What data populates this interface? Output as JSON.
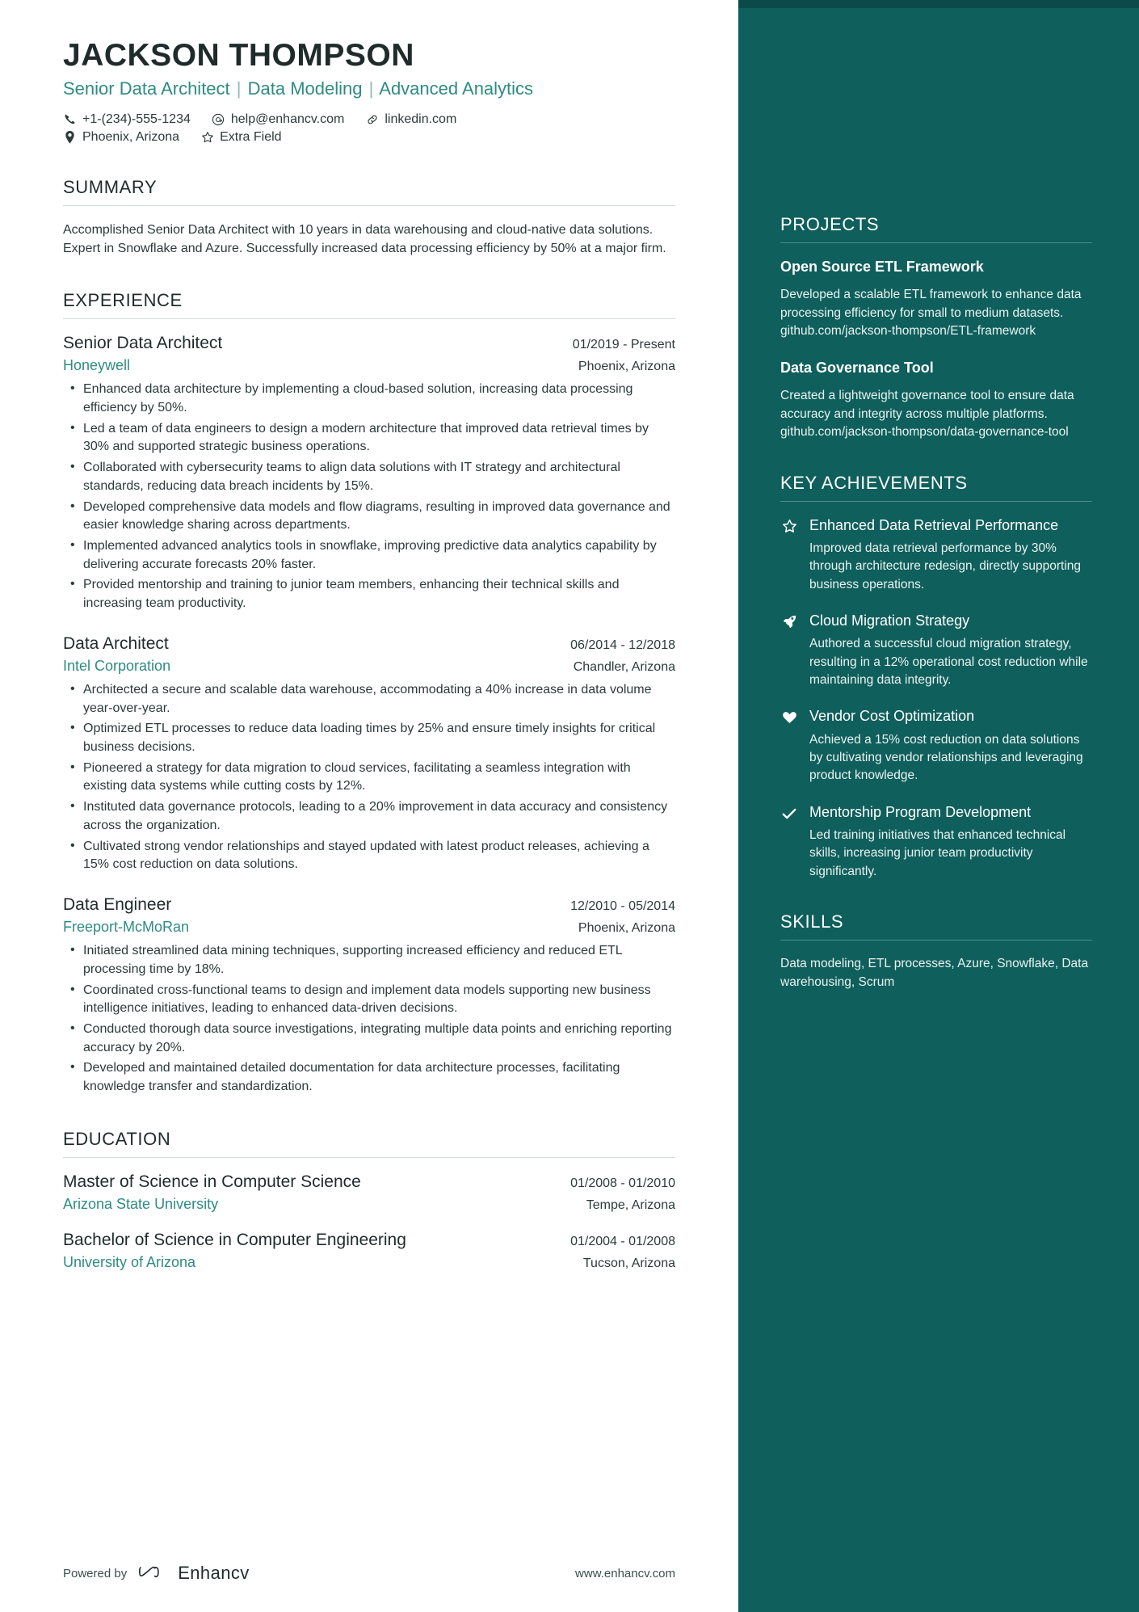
{
  "header": {
    "name": "JACKSON THOMPSON",
    "headline_parts": [
      "Senior Data Architect",
      "Data Modeling",
      "Advanced Analytics"
    ],
    "headline_separator": "|",
    "contacts_row1": [
      {
        "icon": "phone-icon",
        "text": "+1-(234)-555-1234"
      },
      {
        "icon": "email-icon",
        "text": "help@enhancv.com"
      },
      {
        "icon": "link-icon",
        "text": "linkedin.com"
      }
    ],
    "contacts_row2": [
      {
        "icon": "location-pin-icon",
        "text": "Phoenix, Arizona"
      },
      {
        "icon": "star-icon",
        "text": "Extra Field"
      }
    ]
  },
  "summary": {
    "title": "SUMMARY",
    "text": "Accomplished Senior Data Architect with 10 years in data warehousing and cloud-native data solutions. Expert in Snowflake and Azure. Successfully increased data processing efficiency by 50% at a major firm."
  },
  "experience": {
    "title": "EXPERIENCE",
    "jobs": [
      {
        "position": "Senior Data Architect",
        "date": "01/2019 - Present",
        "company": "Honeywell",
        "location": "Phoenix, Arizona",
        "bullets": [
          "Enhanced data architecture by implementing a cloud-based solution, increasing data processing efficiency by 50%.",
          "Led a team of data engineers to design a modern architecture that improved data retrieval times by 30% and supported strategic business operations.",
          "Collaborated with cybersecurity teams to align data solutions with IT strategy and architectural standards, reducing data breach incidents by 15%.",
          "Developed comprehensive data models and flow diagrams, resulting in improved data governance and easier knowledge sharing across departments.",
          "Implemented advanced analytics tools in snowflake, improving predictive data analytics capability by delivering accurate forecasts 20% faster.",
          "Provided mentorship and training to junior team members, enhancing their technical skills and increasing team productivity."
        ]
      },
      {
        "position": "Data Architect",
        "date": "06/2014 - 12/2018",
        "company": "Intel Corporation",
        "location": "Chandler, Arizona",
        "bullets": [
          "Architected a secure and scalable data warehouse, accommodating a 40% increase in data volume year-over-year.",
          "Optimized ETL processes to reduce data loading times by 25% and ensure timely insights for critical business decisions.",
          "Pioneered a strategy for data migration to cloud services, facilitating a seamless integration with existing data systems while cutting costs by 12%.",
          "Instituted data governance protocols, leading to a 20% improvement in data accuracy and consistency across the organization.",
          "Cultivated strong vendor relationships and stayed updated with latest product releases, achieving a 15% cost reduction on data solutions."
        ]
      },
      {
        "position": "Data Engineer",
        "date": "12/2010 - 05/2014",
        "company": "Freeport-McMoRan",
        "location": "Phoenix, Arizona",
        "bullets": [
          "Initiated streamlined data mining techniques, supporting increased efficiency and reduced ETL processing time by 18%.",
          "Coordinated cross-functional teams to design and implement data models supporting new business intelligence initiatives, leading to enhanced data-driven decisions.",
          "Conducted thorough data source investigations, integrating multiple data points and enriching reporting accuracy by 20%.",
          "Developed and maintained detailed documentation for data architecture processes, facilitating knowledge transfer and standardization."
        ]
      }
    ]
  },
  "education": {
    "title": "EDUCATION",
    "entries": [
      {
        "degree": "Master of Science in Computer Science",
        "date": "01/2008 - 01/2010",
        "school": "Arizona State University",
        "location": "Tempe, Arizona"
      },
      {
        "degree": "Bachelor of Science in Computer Engineering",
        "date": "01/2004 - 01/2008",
        "school": "University of Arizona",
        "location": "Tucson, Arizona"
      }
    ]
  },
  "projects": {
    "title": "PROJECTS",
    "items": [
      {
        "name": "Open Source ETL Framework",
        "description": "Developed a scalable ETL framework to enhance data processing efficiency for small to medium datasets. github.com/jackson-thompson/ETL-framework"
      },
      {
        "name": "Data Governance Tool",
        "description": "Created a lightweight governance tool to ensure data accuracy and integrity across multiple platforms. github.com/jackson-thompson/data-governance-tool"
      }
    ]
  },
  "achievements": {
    "title": "KEY ACHIEVEMENTS",
    "items": [
      {
        "icon": "star-outline-icon",
        "title": "Enhanced Data Retrieval Performance",
        "description": "Improved data retrieval performance by 30% through architecture redesign, directly supporting business operations."
      },
      {
        "icon": "rocket-icon",
        "title": "Cloud Migration Strategy",
        "description": "Authored a successful cloud migration strategy, resulting in a 12% operational cost reduction while maintaining data integrity."
      },
      {
        "icon": "heart-icon",
        "title": "Vendor Cost Optimization",
        "description": "Achieved a 15% cost reduction on data solutions by cultivating vendor relationships and leveraging product knowledge."
      },
      {
        "icon": "check-icon",
        "title": "Mentorship Program Development",
        "description": "Led training initiatives that enhanced technical skills, increasing junior team productivity significantly."
      }
    ]
  },
  "skills": {
    "title": "SKILLS",
    "text": "Data modeling, ETL processes, Azure, Snowflake, Data warehousing, Scrum"
  },
  "footer": {
    "powered_by": "Powered by",
    "brand": "Enhancv",
    "url": "www.enhancv.com"
  },
  "colors": {
    "accent_teal": "#2e8b84",
    "sidebar_bg": "#0f5f5c",
    "sidebar_top_bar": "#0b4a48",
    "text_dark": "#2c3a3a"
  }
}
